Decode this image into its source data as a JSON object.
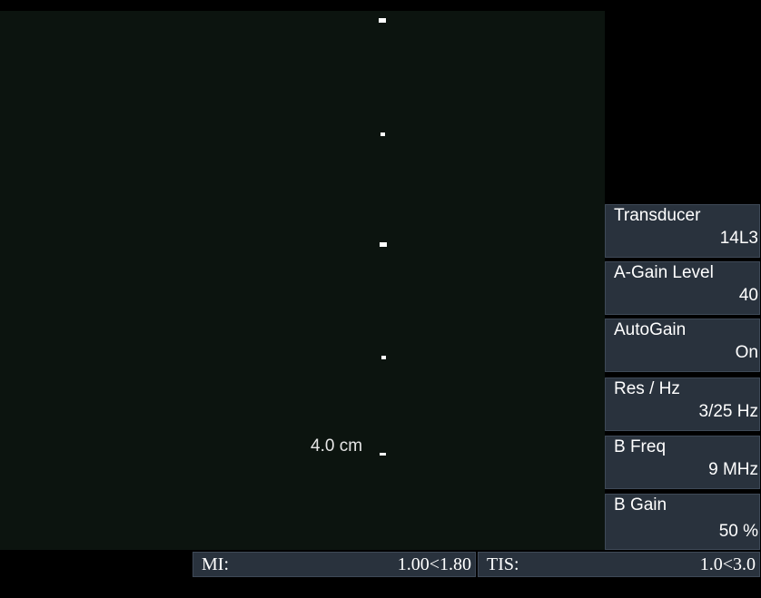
{
  "scale": {
    "depth_label": "4.0 cm"
  },
  "params": [
    {
      "label": "Transducer",
      "value": "14L3"
    },
    {
      "label": "A-Gain Level",
      "value": "40"
    },
    {
      "label": "AutoGain",
      "value": "On"
    },
    {
      "label": "Res / Hz",
      "value": "3/25 Hz"
    },
    {
      "label": "B Freq",
      "value": "9 MHz"
    },
    {
      "label": "B Gain",
      "value": "50 %"
    }
  ],
  "status": {
    "mi_label": "MI:",
    "mi_value": "1.00<1.80",
    "tis_label": "TIS:",
    "tis_value": "1.0<3.0"
  },
  "colors": {
    "image_bg": "#0c140f",
    "panel_bg": "#29323d",
    "text": "#ffffff"
  }
}
